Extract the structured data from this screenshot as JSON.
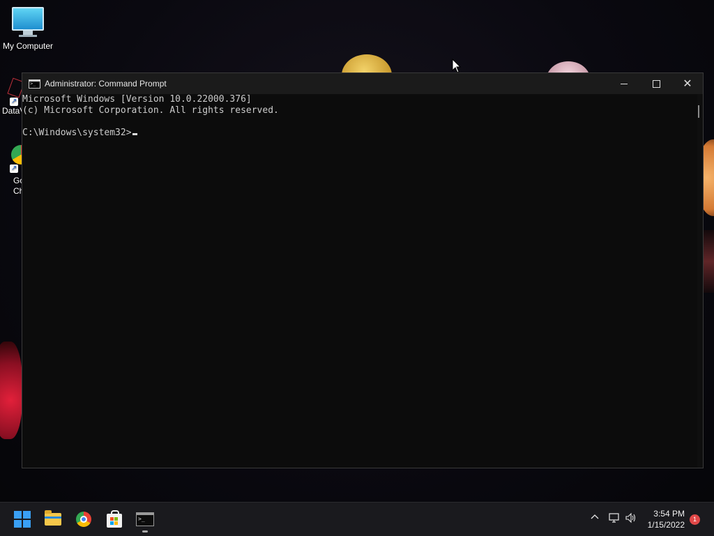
{
  "desktop": {
    "icons": [
      {
        "label": "My Computer"
      },
      {
        "label": "DataV"
      },
      {
        "label": "Go Ch"
      }
    ]
  },
  "window": {
    "title": "Administrator: Command Prompt",
    "console_lines": [
      "Microsoft Windows [Version 10.0.22000.376]",
      "(c) Microsoft Corporation. All rights reserved.",
      "",
      "C:\\Windows\\system32>"
    ],
    "icon": "cmd-icon"
  },
  "taskbar": {
    "pinned": [
      {
        "name": "start-icon"
      },
      {
        "name": "file-explorer-icon"
      },
      {
        "name": "chrome-icon"
      },
      {
        "name": "store-icon"
      },
      {
        "name": "terminal-icon"
      }
    ],
    "tray": {
      "time": "3:54 PM",
      "date": "1/15/2022",
      "notification_count": "1"
    }
  },
  "colors": {
    "console_bg": "#0c0c0c",
    "titlebar_bg": "#1b1b1b",
    "taskbar_bg": "#1a1a1e",
    "accent": "#3aa0f5"
  }
}
